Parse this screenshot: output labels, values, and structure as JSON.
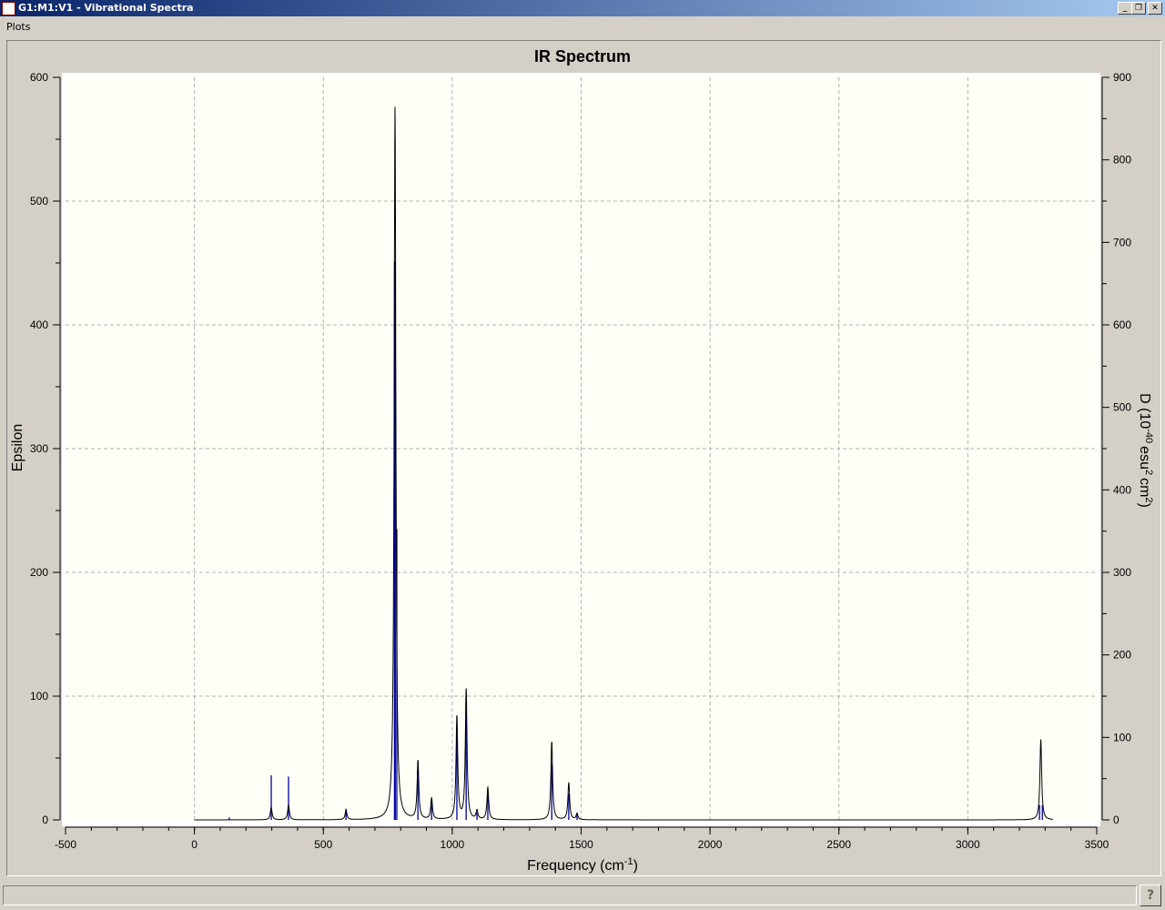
{
  "window": {
    "title": "G1:M1:V1 - Vibrational Spectra",
    "controls": [
      "_",
      "❐",
      "✕"
    ]
  },
  "menu": [
    "Plots"
  ],
  "help_label": "?",
  "chart_data": {
    "type": "line",
    "title": "IR Spectrum",
    "xlabel": "Frequency (cm",
    "xlabel_sup": "-1",
    "xlabel_end": ")",
    "ylabel": "Epsilon",
    "y2label": "D (10",
    "y2label_parts": [
      "-40",
      "esu",
      "2",
      "cm",
      "2",
      ")"
    ],
    "xlim": [
      -500,
      3500
    ],
    "ylim": [
      0,
      600
    ],
    "y2lim": [
      0,
      900
    ],
    "xticks": [
      -500,
      0,
      500,
      1000,
      1500,
      2000,
      2500,
      3000,
      3500
    ],
    "yticks": [
      0,
      100,
      200,
      300,
      400,
      500,
      600
    ],
    "y2ticks": [
      0,
      100,
      200,
      300,
      400,
      500,
      600,
      700,
      800,
      900
    ],
    "grid": true,
    "colors": {
      "curve": "#000000",
      "sticks": "#0000a0",
      "plot_bg": "#fffff8"
    },
    "sticks": {
      "x": [
        135,
        298,
        365,
        588,
        776,
        779,
        785,
        867,
        920,
        1018,
        1054,
        1096,
        1138,
        1386,
        1452,
        1484,
        3278,
        3289
      ],
      "y": [
        2,
        36,
        35,
        9,
        451,
        451,
        235,
        48,
        17,
        69,
        89,
        6,
        20,
        45,
        21,
        4,
        12,
        12
      ]
    },
    "curve_peaks": {
      "x": [
        298,
        365,
        588,
        778,
        867,
        920,
        1018,
        1054,
        1096,
        1138,
        1386,
        1452,
        1484,
        3283
      ],
      "y": [
        10,
        12,
        8,
        576,
        47,
        17,
        83,
        105,
        7,
        26,
        63,
        30,
        5,
        65
      ]
    }
  }
}
